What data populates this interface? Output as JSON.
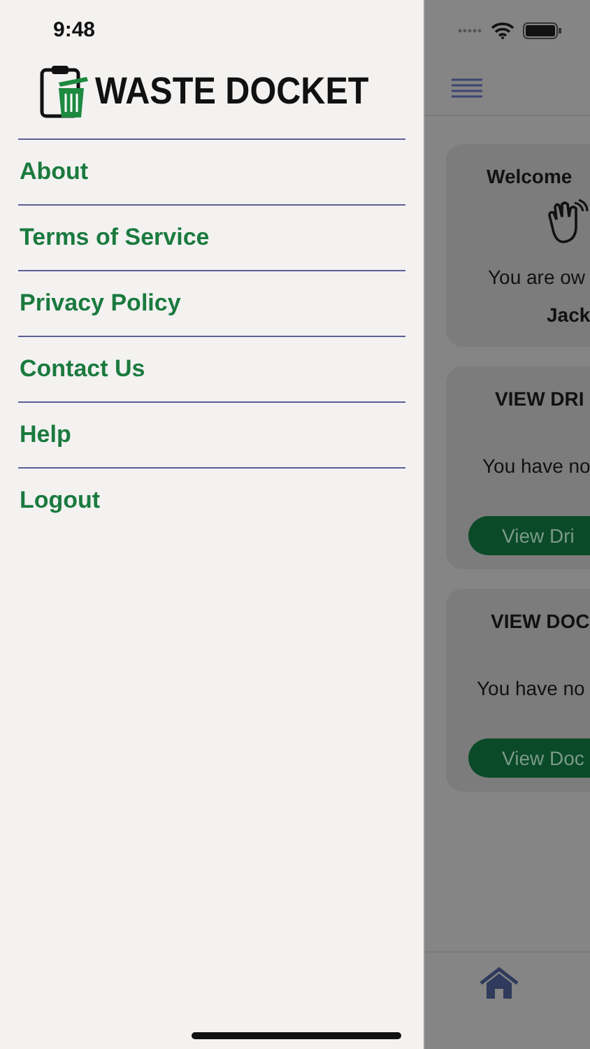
{
  "status_bar": {
    "time": "9:48"
  },
  "drawer": {
    "logo": "WASTE DOCKET",
    "items": [
      {
        "label": "About"
      },
      {
        "label": "Terms of Service"
      },
      {
        "label": "Privacy Policy"
      },
      {
        "label": "Contact Us"
      },
      {
        "label": "Help"
      },
      {
        "label": "Logout"
      }
    ]
  },
  "main": {
    "welcome_card": {
      "title": "Welcome",
      "line": "You are ow",
      "name": "Jack"
    },
    "cards": [
      {
        "title": "VIEW DRI",
        "message": "You have no",
        "button": "View Dri"
      },
      {
        "title": "VIEW DOC",
        "message": "You have no",
        "button": "View Doc"
      }
    ]
  }
}
